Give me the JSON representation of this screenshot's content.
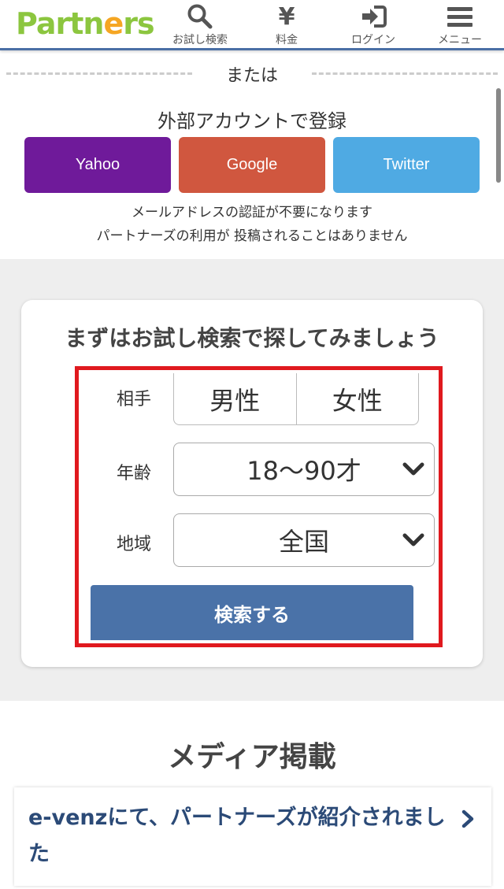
{
  "header": {
    "logo": {
      "part1": "Partn",
      "part2": "e",
      "part3": "rs"
    },
    "nav": [
      {
        "label": "お試し検索",
        "icon": "search-icon"
      },
      {
        "label": "料金",
        "icon": "yen-icon",
        "glyph": "¥"
      },
      {
        "label": "ログイン",
        "icon": "login-icon"
      },
      {
        "label": "メニュー",
        "icon": "hamburger-menu-icon"
      }
    ]
  },
  "divider": {
    "label": "または"
  },
  "external": {
    "title": "外部アカウントで登録",
    "buttons": [
      {
        "label": "Yahoo",
        "color": "#6f1a9a"
      },
      {
        "label": "Google",
        "color": "#d0573f"
      },
      {
        "label": "Twitter",
        "color": "#4faae3"
      }
    ],
    "notes": [
      "メールアドレスの認証が不要になります",
      "パートナーズの利用が 投稿されることはありません"
    ]
  },
  "trial": {
    "title": "まずはお試し検索で探してみましょう",
    "partner_label": "相手",
    "gender_options": [
      "男性",
      "女性"
    ],
    "age_label": "年齢",
    "age_value": "18〜90才",
    "region_label": "地域",
    "region_value": "全国",
    "search_button": "検索する"
  },
  "media": {
    "title": "メディア掲載",
    "items": [
      {
        "text": "e-venzにて、パートナーズが紹介されました"
      }
    ]
  },
  "colors": {
    "accent": "#4a72a8",
    "highlight_frame": "#e0191e",
    "logo_green": "#8cc63f",
    "logo_orange": "#f5a623"
  }
}
